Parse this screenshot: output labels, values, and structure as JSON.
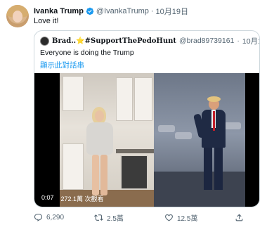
{
  "tweet": {
    "name": "Ivanka Trump",
    "handle": "@IvankaTrump",
    "separator": "·",
    "date": "10月19日",
    "text": "Love it!"
  },
  "quote": {
    "name": "Brad..⭐#SupportThePedoHunt",
    "handle": "@brad89739161",
    "separator": "·",
    "date": "10月18日",
    "text": "Everyone is doing the Trump",
    "show_thread": "顯示此對話串",
    "video": {
      "duration": "0:07",
      "views": "272.1萬 次觀看"
    }
  },
  "actions": {
    "reply_count": "6,290",
    "retweet_count": "2.5萬",
    "like_count": "12.5萬"
  },
  "colors": {
    "verified": "#1d9bf0",
    "link": "#1d9bf0",
    "muted": "#536471"
  }
}
